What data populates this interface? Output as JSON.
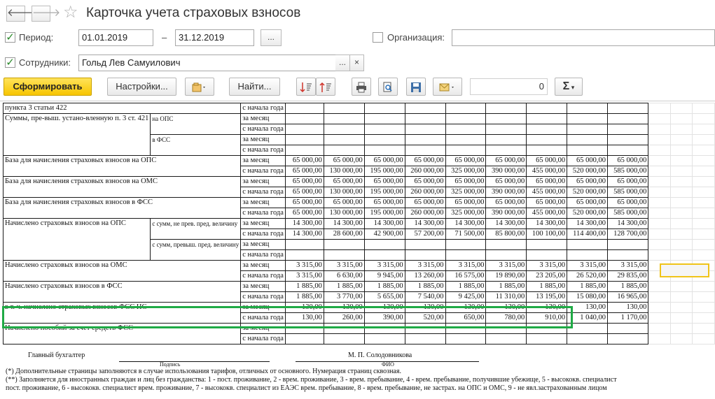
{
  "window": {
    "title": "Карточка учета страховых взносов",
    "back_icon": "arrow-left-icon",
    "forward_icon": "arrow-right-icon",
    "favorite_icon": "star-icon"
  },
  "filters": {
    "period_label": "Период:",
    "period_from": "01.01.2019",
    "period_dash": "–",
    "period_to": "31.12.2019",
    "period_button": "...",
    "org_label": "Организация:",
    "org_value": "",
    "employees_label": "Сотрудники:",
    "employees_value": "Гольд Лев Самуилович",
    "employees_select": "...",
    "employees_clear": "×"
  },
  "toolbar": {
    "generate": "Сформировать",
    "settings": "Настройки...",
    "find": "Найти...",
    "counter": "0",
    "sum_symbol": "Σ"
  },
  "report": {
    "rows": [
      {
        "label": "пункта 3 статьи 422",
        "sub": "",
        "period": "с начала года",
        "values": [
          "",
          "",
          "",
          "",
          "",
          "",
          "",
          "",
          ""
        ]
      },
      {
        "label": "Суммы, пре-выш. устано-вленную п. 3 ст. 421",
        "sub": "на ОПС",
        "period": "за месяц",
        "values": [
          "",
          "",
          "",
          "",
          "",
          "",
          "",
          "",
          ""
        ]
      },
      {
        "label": "",
        "sub": "",
        "period": "с начала года",
        "values": [
          "",
          "",
          "",
          "",
          "",
          "",
          "",
          "",
          ""
        ]
      },
      {
        "label": "",
        "sub": "в ФСС",
        "period": "за месяц",
        "values": [
          "",
          "",
          "",
          "",
          "",
          "",
          "",
          "",
          ""
        ]
      },
      {
        "label": "",
        "sub": "",
        "period": "с начала года",
        "values": [
          "",
          "",
          "",
          "",
          "",
          "",
          "",
          "",
          ""
        ]
      },
      {
        "label": "База для начисления страховых взносов на ОПС",
        "sub": "",
        "period": "за месяц",
        "values": [
          "65 000,00",
          "65 000,00",
          "65 000,00",
          "65 000,00",
          "65 000,00",
          "65 000,00",
          "65 000,00",
          "65 000,00",
          "65 000,00"
        ]
      },
      {
        "label": "",
        "sub": "",
        "period": "с начала года",
        "values": [
          "65 000,00",
          "130 000,00",
          "195 000,00",
          "260 000,00",
          "325 000,00",
          "390 000,00",
          "455 000,00",
          "520 000,00",
          "585 000,00"
        ]
      },
      {
        "label": "База для начисления страховых взносов на ОМС",
        "sub": "",
        "period": "за месяц",
        "values": [
          "65 000,00",
          "65 000,00",
          "65 000,00",
          "65 000,00",
          "65 000,00",
          "65 000,00",
          "65 000,00",
          "65 000,00",
          "65 000,00"
        ]
      },
      {
        "label": "",
        "sub": "",
        "period": "с начала года",
        "values": [
          "65 000,00",
          "130 000,00",
          "195 000,00",
          "260 000,00",
          "325 000,00",
          "390 000,00",
          "455 000,00",
          "520 000,00",
          "585 000,00"
        ]
      },
      {
        "label": "База для начисления страховых взносов в ФСС",
        "sub": "",
        "period": "за месяц",
        "values": [
          "65 000,00",
          "65 000,00",
          "65 000,00",
          "65 000,00",
          "65 000,00",
          "65 000,00",
          "65 000,00",
          "65 000,00",
          "65 000,00"
        ]
      },
      {
        "label": "",
        "sub": "",
        "period": "с начала года",
        "values": [
          "65 000,00",
          "130 000,00",
          "195 000,00",
          "260 000,00",
          "325 000,00",
          "390 000,00",
          "455 000,00",
          "520 000,00",
          "585 000,00"
        ]
      },
      {
        "label": "Начислено страховых взносов на ОПС",
        "sub": "с сумм, не прев. пред. величину",
        "period": "за месяц",
        "values": [
          "14 300,00",
          "14 300,00",
          "14 300,00",
          "14 300,00",
          "14 300,00",
          "14 300,00",
          "14 300,00",
          "14 300,00",
          "14 300,00"
        ]
      },
      {
        "label": "",
        "sub": "",
        "period": "с начала года",
        "values": [
          "14 300,00",
          "28 600,00",
          "42 900,00",
          "57 200,00",
          "71 500,00",
          "85 800,00",
          "100 100,00",
          "114 400,00",
          "128 700,00"
        ]
      },
      {
        "label": "",
        "sub": "с сумм, превыш. пред. величину",
        "period": "за месяц",
        "values": [
          "",
          "",
          "",
          "",
          "",
          "",
          "",
          "",
          ""
        ]
      },
      {
        "label": "",
        "sub": "",
        "period": "с начала года",
        "values": [
          "",
          "",
          "",
          "",
          "",
          "",
          "",
          "",
          ""
        ]
      },
      {
        "label": "Начислено страховых взносов на ОМС",
        "sub": "",
        "period": "за месяц",
        "values": [
          "3 315,00",
          "3 315,00",
          "3 315,00",
          "3 315,00",
          "3 315,00",
          "3 315,00",
          "3 315,00",
          "3 315,00",
          "3 315,00"
        ]
      },
      {
        "label": "",
        "sub": "",
        "period": "с начала года",
        "values": [
          "3 315,00",
          "6 630,00",
          "9 945,00",
          "13 260,00",
          "16 575,00",
          "19 890,00",
          "23 205,00",
          "26 520,00",
          "29 835,00"
        ]
      },
      {
        "label": "Начислено страховых взносов в ФСС",
        "sub": "",
        "period": "за месяц",
        "values": [
          "1 885,00",
          "1 885,00",
          "1 885,00",
          "1 885,00",
          "1 885,00",
          "1 885,00",
          "1 885,00",
          "1 885,00",
          "1 885,00"
        ]
      },
      {
        "label": "",
        "sub": "",
        "period": "с начала года",
        "values": [
          "1 885,00",
          "3 770,00",
          "5 655,00",
          "7 540,00",
          "9 425,00",
          "11 310,00",
          "13 195,00",
          "15 080,00",
          "16 965,00"
        ]
      },
      {
        "label": "в т. ч. начислено страховых взносов ФСС НС",
        "sub": "",
        "period": "за месяц",
        "values": [
          "130,00",
          "130,00",
          "130,00",
          "130,00",
          "130,00",
          "130,00",
          "130,00",
          "130,00",
          "130,00"
        ]
      },
      {
        "label": "",
        "sub": "",
        "period": "с начала года",
        "values": [
          "130,00",
          "260,00",
          "390,00",
          "520,00",
          "650,00",
          "780,00",
          "910,00",
          "1 040,00",
          "1 170,00"
        ]
      },
      {
        "label": "Начислено пособий за счет средств ФСС",
        "sub": "",
        "period": "за месяц",
        "values": [
          "",
          "",
          "",
          "",
          "",
          "",
          "",
          "",
          ""
        ]
      },
      {
        "label": "",
        "sub": "",
        "period": "с начала года",
        "values": [
          "",
          "",
          "",
          "",
          "",
          "",
          "",
          "",
          ""
        ]
      }
    ],
    "footer": {
      "chief_accountant": "Главный бухгалтер",
      "signature_caption": "Подпись",
      "chief_name": "М. П. Солодовникова",
      "name_caption": "ФИО",
      "note1": "(*) Дополнительные страницы заполняются в случае использования тарифов, отличных от основного. Нумерация страниц сквозная.",
      "note2": "(**) Заполняется для иностранных граждан и лиц без гражданства: 1 - пост. проживание, 2 - врем. проживание, 3 - врем. пребывание, 4 - врем. пребывание, получившие убежище, 5 - высококв. специалист",
      "note3": "пост. проживание, 6 - высококв. специалист врем. проживание, 7 - высококв. специалист из ЕАЭС врем. пребывание, 8 - врем. пребывание, не застрах. на ОПС и ОМС, 9 - не явл.застрахованным лицом"
    }
  }
}
